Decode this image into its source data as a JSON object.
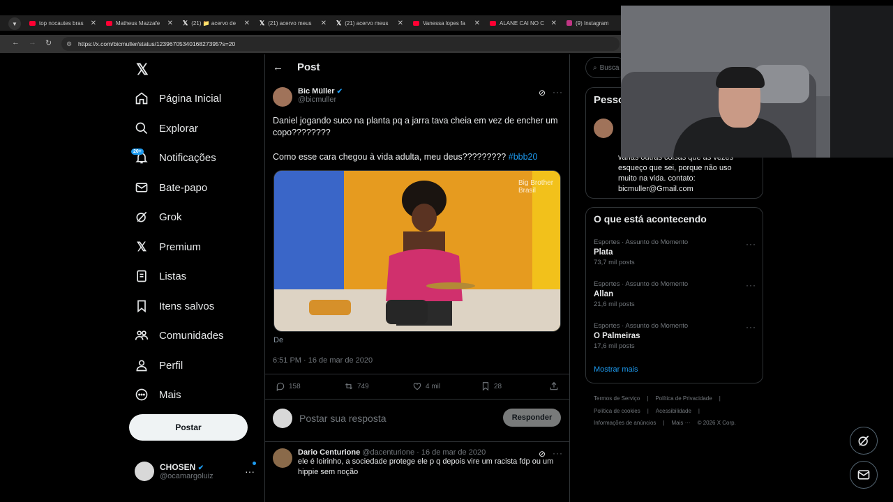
{
  "browser": {
    "tabs": [
      {
        "label": "top nocautes bras",
        "icon": "youtube-icon"
      },
      {
        "label": "Matheus Mazzafe",
        "icon": "youtube-icon"
      },
      {
        "label": "(21) 📁 acervo de",
        "icon": "x-icon"
      },
      {
        "label": "(21) acervo meus",
        "icon": "x-icon"
      },
      {
        "label": "(21) acervo meus",
        "icon": "x-icon"
      },
      {
        "label": "Vanessa lopes fa",
        "icon": "youtube-icon"
      },
      {
        "label": "ALANE CAI NO C",
        "icon": "youtube-icon"
      },
      {
        "label": "(9) Instagram",
        "icon": "instagram-icon"
      }
    ],
    "url": "https://x.com/bicmuller/status/1239670534016827395?s=20"
  },
  "nav": {
    "items": [
      {
        "label": "Página Inicial",
        "icon": "home-icon"
      },
      {
        "label": "Explorar",
        "icon": "search-icon"
      },
      {
        "label": "Notificações",
        "icon": "bell-icon"
      },
      {
        "label": "Bate-papo",
        "icon": "mail-icon"
      },
      {
        "label": "Grok",
        "icon": "grok-icon"
      },
      {
        "label": "Premium",
        "icon": "x-logo-icon"
      },
      {
        "label": "Listas",
        "icon": "list-icon"
      },
      {
        "label": "Itens salvos",
        "icon": "bookmark-icon"
      },
      {
        "label": "Comunidades",
        "icon": "people-icon"
      },
      {
        "label": "Perfil",
        "icon": "person-icon"
      },
      {
        "label": "Mais",
        "icon": "more-circle-icon"
      }
    ],
    "notif_badge": "20+",
    "post_button": "Postar",
    "account": {
      "name": "CHOSEN",
      "handle": "@ocamargoluiz"
    }
  },
  "header": {
    "title": "Post"
  },
  "post": {
    "author_name": "Bic Müller",
    "author_handle": "@bicmuller",
    "text_line1": "Daniel jogando suco na planta pq a jarra tava cheia em vez de encher um copo????????",
    "text_line2": "Como esse cara chegou à vida adulta, meu deus?????????",
    "hashtag": "#bbb20",
    "media_watermark": "Big Brother Brasil",
    "media_caption": "De",
    "timestamp": "6:51 PM · 16 de mar de 2020",
    "replies": "158",
    "reposts": "749",
    "likes": "4 mil",
    "bookmarks": "28"
  },
  "reply_box": {
    "placeholder": "Postar sua resposta",
    "button": "Responder"
  },
  "comment": {
    "name": "Dario Centurione",
    "handle": "@dacenturione · 16 de mar de 2020",
    "text": "ele é loirinho, a sociedade protege ele p q depois vire um racista fdp ou um hippie sem noção"
  },
  "sidebar": {
    "search_placeholder": "Busca",
    "who_title": "Pesso",
    "bio": "várias outras coisas que as vezes esqueço que sei, porque não uso muito na vida. contato: bicmuller@Gmail.com",
    "trends_title": "O que está acontecendo",
    "trends": [
      {
        "category": "Esportes · Assunto do Momento",
        "name": "Plata",
        "count": "73,7 mil posts"
      },
      {
        "category": "Esportes · Assunto do Momento",
        "name": "Allan",
        "count": "21,6 mil posts"
      },
      {
        "category": "Esportes · Assunto do Momento",
        "name": "O Palmeiras",
        "count": "17,6 mil posts"
      }
    ],
    "show_more": "Mostrar mais",
    "footer_row1": [
      "Termos de Serviço",
      "|",
      "Política de Privacidade",
      "|"
    ],
    "footer_row2": [
      "Política de cookies",
      "|",
      "Acessibilidade",
      "|"
    ],
    "footer_row3": [
      "Informações de anúncios",
      "|",
      "Mais ···",
      "© 2026 X Corp."
    ]
  },
  "colors": {
    "accent": "#1d9bf0",
    "background": "#000000",
    "text": "#e7e9ea",
    "muted": "#71767b",
    "border": "#2f3336"
  }
}
